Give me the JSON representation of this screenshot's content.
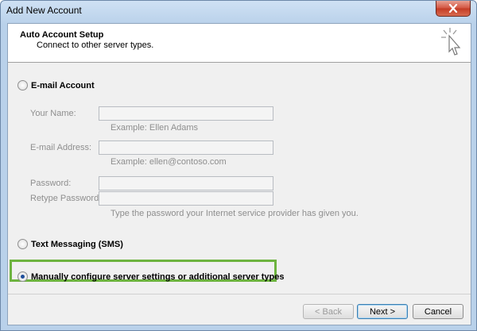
{
  "window": {
    "title": "Add New Account"
  },
  "header": {
    "title": "Auto Account Setup",
    "subtitle": "Connect to other server types."
  },
  "options": {
    "email_account": "E-mail Account",
    "text_messaging": "Text Messaging (SMS)",
    "manual": "Manually configure server settings or additional server types",
    "selected": "manual"
  },
  "form": {
    "your_name_label": "Your Name:",
    "your_name_example": "Example: Ellen Adams",
    "email_label": "E-mail Address:",
    "email_example": "Example: ellen@contoso.com",
    "password_label": "Password:",
    "retype_password_label": "Retype Password:",
    "password_hint": "Type the password your Internet service provider has given you."
  },
  "buttons": {
    "back": "< Back",
    "next": "Next >",
    "cancel": "Cancel"
  },
  "colors": {
    "highlight": "#6db33f",
    "close_button": "#c33a24"
  }
}
